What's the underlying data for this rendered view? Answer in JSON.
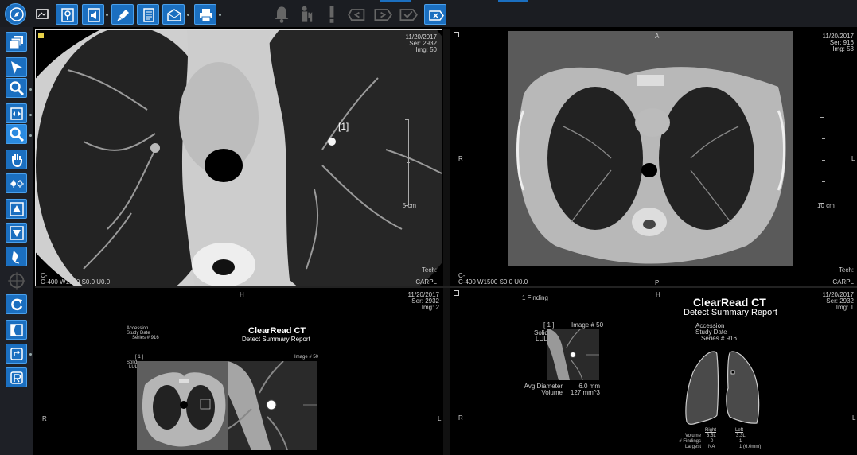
{
  "toolbar": {
    "icons": [
      "compass-icon",
      "image-export-icon",
      "key-icon",
      "speaker-icon",
      "microphone-icon",
      "report-icon",
      "mail-icon",
      "printer-icon",
      "bell-icon",
      "people-icon",
      "alert-icon",
      "arrow-left-box-icon",
      "arrow-right-box-icon",
      "check-box-icon",
      "close-box-icon"
    ]
  },
  "sidebar": {
    "icons": [
      "layers-icon",
      "pointer-icon",
      "zoom-lens-icon",
      "fit-icon",
      "magnifier-icon",
      "pan-hand-icon",
      "window-level-icon",
      "scroll-up-icon",
      "scroll-down-icon",
      "pen-icon",
      "crosshair-icon",
      "reset-icon",
      "invert-icon",
      "rotate-icon",
      "flip-icon"
    ]
  },
  "viewports": {
    "top_left": {
      "date": "11/20/2017",
      "series": "Ser: 2932",
      "image": "Img: 50",
      "wl": "C-400 W1500 S0.0 U0.0",
      "c": "C-",
      "scale": "5 cm",
      "tech": "Tech:",
      "inst": "CARPL",
      "finding_label": "[1]"
    },
    "top_right": {
      "orient_top": "A",
      "orient_left": "R",
      "orient_right": "L",
      "orient_bottom": "P",
      "date": "11/20/2017",
      "series": "Ser: 916",
      "image": "Img: 53",
      "wl": "C-400 W1500 S0.0 U0.0",
      "c": "C-",
      "scale": "10 cm",
      "tech": "Tech:",
      "inst": "CARPL"
    },
    "bottom_left": {
      "orient_top": "H",
      "orient_left": "R",
      "orient_right": "L",
      "date": "11/20/2017",
      "series": "Ser: 2932",
      "image": "Img: 2",
      "report_title": "ClearRead CT",
      "report_sub": "Detect Summary Report",
      "accession": "Accession",
      "study_date": "Study Date",
      "series_no": "Series #  916",
      "finding_id": "[ 1 ]",
      "solid": "Solid",
      "lul": "LUL",
      "image_no": "Image # 50"
    },
    "bottom_right": {
      "orient_top": "H",
      "orient_left": "R",
      "orient_right": "L",
      "date": "11/20/2017",
      "series": "Ser: 2932",
      "image": "Img: 1",
      "findings": "1 Finding",
      "report_title": "ClearRead CT",
      "report_sub": "Detect Summary Report",
      "accession": "Accession",
      "study_date": "Study Date",
      "series_no": "Series #  916",
      "finding_id": "[ 1 ]",
      "image_no": "Image # 50",
      "solid": "Solid",
      "lul": "LUL",
      "avg_diameter_label": "Avg Diameter",
      "avg_diameter_value": "6.0 mm",
      "volume_label": "Volume",
      "volume_value": "127 mm^3",
      "table": {
        "col_right": "Right",
        "col_left": "Left",
        "rows": [
          {
            "label": "Volume",
            "right": "3.5L",
            "left": "3.3L"
          },
          {
            "label": "# Findings",
            "right": "0",
            "left": "1"
          },
          {
            "label": "Largest",
            "right": "NA",
            "left": "1 (6.0mm)"
          }
        ]
      }
    }
  },
  "colors": {
    "accent": "#1b6fc0",
    "accent_border": "#4aa0ec",
    "toolbar_bg": "#1b1d22"
  }
}
